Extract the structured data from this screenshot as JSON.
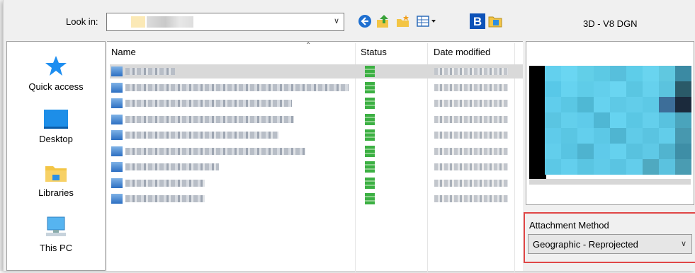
{
  "toolbar": {
    "look_in_label": "Look in:",
    "look_in_value": "",
    "icons": [
      "back-icon",
      "up-folder-icon",
      "new-folder-icon",
      "view-menu-icon",
      "bentley-b-icon",
      "attach-image-icon"
    ]
  },
  "places": [
    {
      "label": "Quick access",
      "icon": "quick-access-star-icon"
    },
    {
      "label": "Desktop",
      "icon": "desktop-icon"
    },
    {
      "label": "Libraries",
      "icon": "libraries-icon"
    },
    {
      "label": "This PC",
      "icon": "this-pc-icon"
    }
  ],
  "file_list": {
    "columns": [
      "Name",
      "Status",
      "Date modified"
    ],
    "rows": [
      {
        "name": "",
        "status": "",
        "date": "",
        "selected": true
      },
      {
        "name": "",
        "status": "",
        "date": "",
        "selected": false
      },
      {
        "name": "",
        "status": "",
        "date": "",
        "selected": false
      },
      {
        "name": "",
        "status": "",
        "date": "",
        "selected": false
      },
      {
        "name": "",
        "status": "",
        "date": "",
        "selected": false
      },
      {
        "name": "",
        "status": "",
        "date": "",
        "selected": false
      },
      {
        "name": "",
        "status": "",
        "date": "",
        "selected": false
      },
      {
        "name": "",
        "status": "",
        "date": "",
        "selected": false
      },
      {
        "name": "",
        "status": "",
        "date": "",
        "selected": false
      }
    ]
  },
  "preview": {
    "title": "3D - V8 DGN"
  },
  "attachment": {
    "label": "Attachment Method",
    "value": "Geographic - Reprojected"
  },
  "colors": {
    "highlight_border": "#e04646",
    "selected_row": "#d9d9d9",
    "status_green": "#3cb043"
  }
}
